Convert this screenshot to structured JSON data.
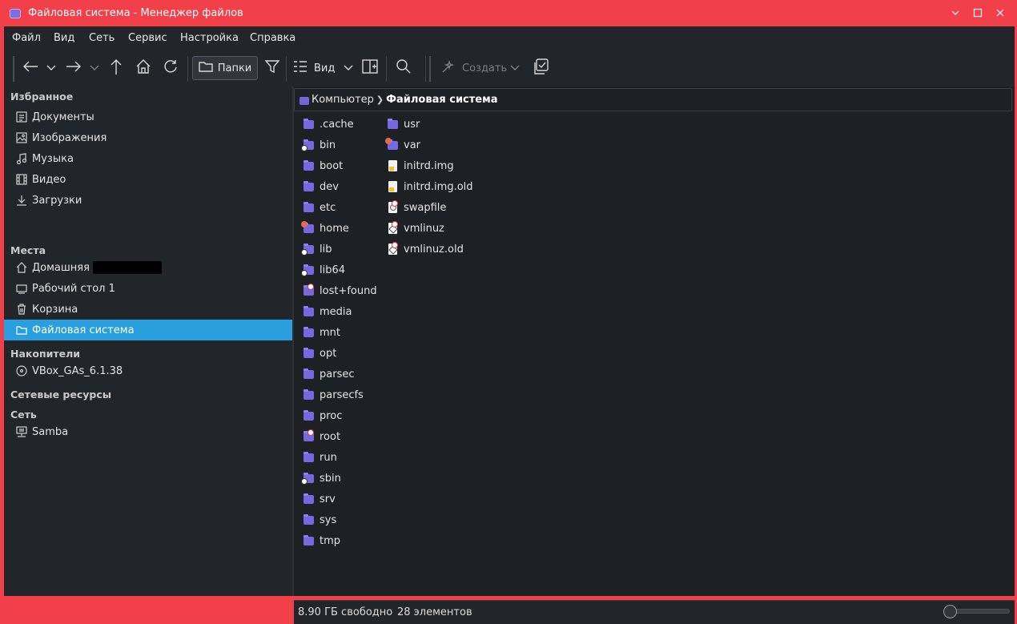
{
  "window": {
    "title": "Файловая система - Менеджер файлов"
  },
  "menu": [
    "Файл",
    "Вид",
    "Сеть",
    "Сервис",
    "Настройка",
    "Справка"
  ],
  "toolbar": {
    "folders_label": "Папки",
    "view_label": "Вид",
    "create_label": "Создать"
  },
  "sidebar": {
    "favorites_header": "Избранное",
    "favorites": [
      "Документы",
      "Изображения",
      "Музыка",
      "Видео",
      "Загрузки"
    ],
    "places_header": "Места",
    "places": [
      "Домашняя",
      "Рабочий стол 1",
      "Корзина",
      "Файловая система"
    ],
    "drives_header": "Накопители",
    "drives": [
      "VBox_GAs_6.1.38"
    ],
    "network_resources_header": "Сетевые ресурсы",
    "network_header": "Сеть",
    "network": [
      "Samba"
    ]
  },
  "breadcrumb": {
    "parent": "Компьютер",
    "current": "Файловая система"
  },
  "files_col1": [
    ".cache",
    "bin",
    "boot",
    "dev",
    "etc",
    "home",
    "lib",
    "lib64",
    "lost+found",
    "media",
    "mnt",
    "opt",
    "parsec",
    "parsecfs",
    "proc",
    "root",
    "run",
    "sbin",
    "srv",
    "sys",
    "tmp"
  ],
  "files_col2": [
    "usr",
    "var",
    "initrd.img",
    "initrd.img.old",
    "swapfile",
    "vmlinuz",
    "vmlinuz.old"
  ],
  "status": {
    "free_space": "8.90 ГБ свободно",
    "items_count": "28 элементов",
    "zoom_level": 0
  },
  "colors": {
    "accent": "#2a9fdf",
    "titlebar": "#f1404a",
    "folder": "#7669e0"
  }
}
